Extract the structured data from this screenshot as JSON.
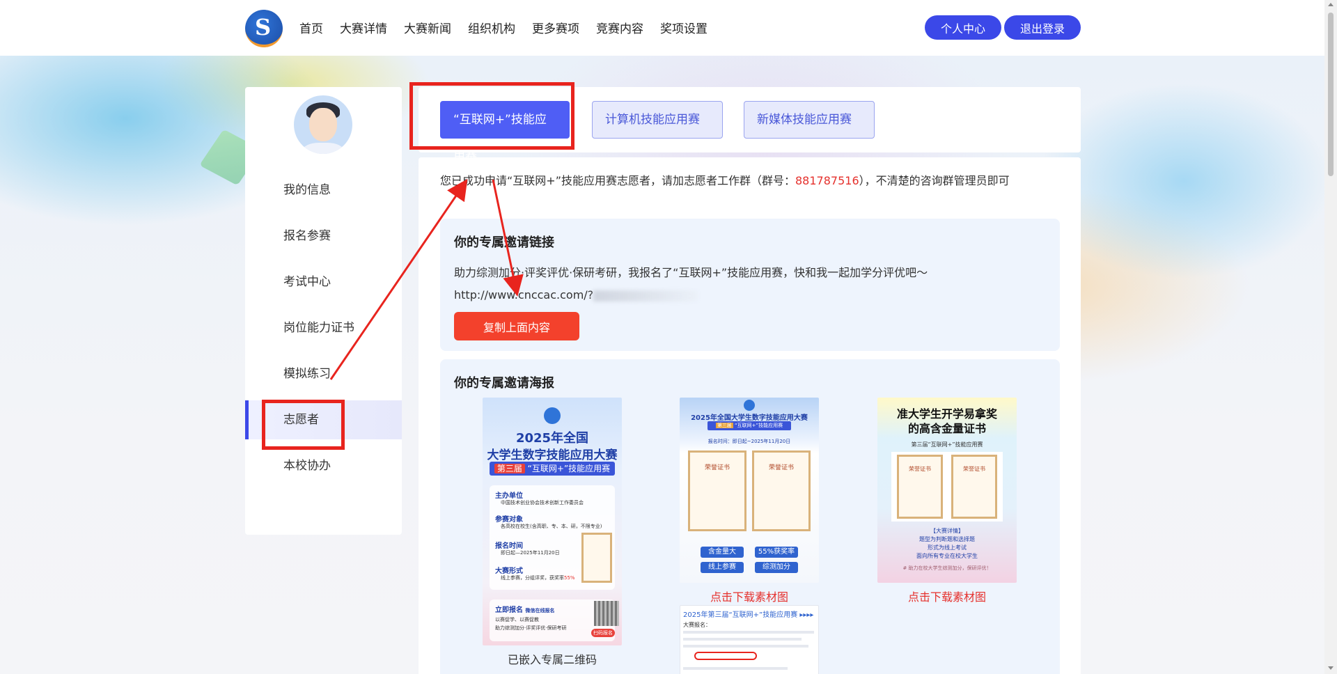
{
  "nav": {
    "items": [
      "首页",
      "大赛详情",
      "大赛新闻",
      "组织机构",
      "更多赛项",
      "竞赛内容",
      "奖项设置"
    ],
    "profile_btn": "个人中心",
    "logout_btn": "退出登录"
  },
  "sidebar": {
    "items": [
      "我的信息",
      "报名参赛",
      "考试中心",
      "岗位能力证书",
      "模拟练习",
      "志愿者",
      "本校协办"
    ],
    "active": "志愿者"
  },
  "tabs": [
    "“互联网+”技能应用赛",
    "计算机技能应用赛",
    "新媒体技能应用赛"
  ],
  "notice": {
    "before": "您已成功申请“互联网+”技能应用赛志愿者，请加志愿者工作群（群号：",
    "group_no": "881787516",
    "after": "），不清楚的咨询群管理员即可"
  },
  "invite": {
    "title": "你的专属邀请链接",
    "text": "助力综测加分·评奖评优·保研考研，我报名了“互联网+”技能应用赛，快和我一起加学分评优吧～",
    "link": "http://www.cnccac.com/?",
    "copy_btn": "复制上面内容"
  },
  "posters": {
    "title": "你的专属邀请海报",
    "p1": {
      "title": "2025年全国",
      "title2": "大学生数字技能应用大赛",
      "badge": "第三届",
      "subtitle": "“互联网+”技能应用赛",
      "r1": "主办单位",
      "r1t": "中国技术创业协会技术创新工作委员会",
      "r2": "参赛对象",
      "r2t": "各高校在校生(含高职、专、本、研，不限专业)",
      "r3": "报名时间",
      "r3t": "即日起—2025年11月20日",
      "r4": "大赛形式",
      "r4t": "线上参赛，分组评奖，获奖率",
      "r4p": "55%",
      "reg": "立即报名",
      "reg2": "微信在线报名",
      "line1": "以赛促学、以赛促教",
      "line2": "助力综测加分·评奖评优·保研考研",
      "scan": "扫码报名",
      "caption": "已嵌入专属二维码"
    },
    "p2": {
      "title": "2025年全国大学生数字技能应用大赛",
      "badge": "第三届",
      "subtitle": "“互联网+”技能应用赛",
      "deadline": "报名时间：即日起~2025年11月20日",
      "cert": "荣誉证书",
      "pills": [
        "含金量大",
        "55%获奖率",
        "线上参赛",
        "综测加分"
      ],
      "caption": "点击下载素材图"
    },
    "p3": {
      "title": "准大学生开学易拿奖",
      "title2": "的高含金量证书",
      "sub": "第三届“互联网+”技能应用赛",
      "cert": "荣誉证书",
      "d1": "【大赛详情】",
      "d2": "题型为判断题和选择题",
      "d3": "形式为线上考试",
      "d4": "面向所有专业在校大学生",
      "foot": "# 助力在校大学生综测加分，保研评优！",
      "caption": "点击下载素材图"
    },
    "p4": {
      "title": "2025年第三届“互联网+”技能应用赛 ▸▸▸▸",
      "sub": "大赛报名："
    }
  },
  "colors": {
    "accent": "#3b48e8",
    "tab_active": "#4f5ef5",
    "danger": "#f3412c",
    "group_no": "#e5302c",
    "annotation": "#e8241e"
  }
}
